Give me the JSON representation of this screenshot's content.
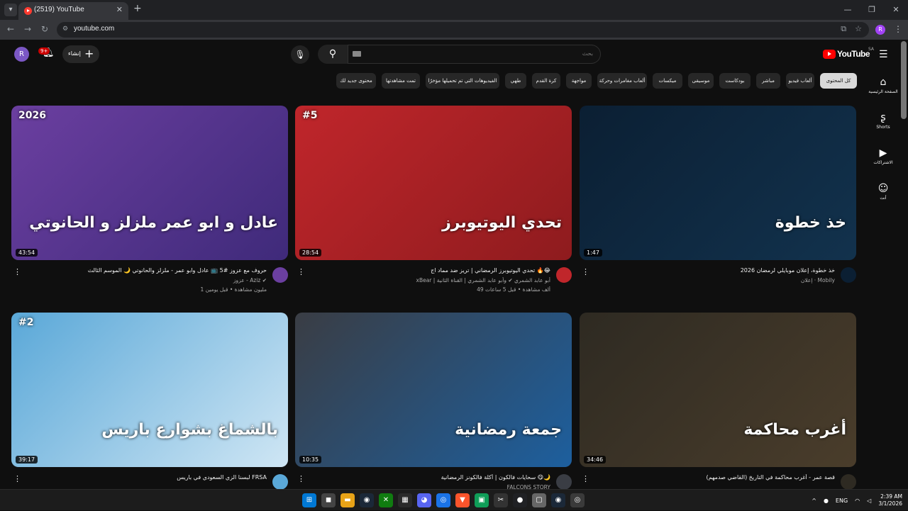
{
  "browser": {
    "tab_title": "(2519) YouTube",
    "url": "youtube.com",
    "profile_initial": "R"
  },
  "masthead": {
    "avatar_initial": "R",
    "notification_count": "9+",
    "create_label": "إنشاء",
    "search_placeholder": "بحث",
    "logo_text": "YouTube",
    "region": "SA"
  },
  "chips": [
    {
      "label": "كل المحتوى",
      "active": true
    },
    {
      "label": "ألعاب فيديو",
      "active": false
    },
    {
      "label": "مباشر",
      "active": false
    },
    {
      "label": "بودكاست",
      "active": false
    },
    {
      "label": "موسيقى",
      "active": false
    },
    {
      "label": "ميكسات",
      "active": false
    },
    {
      "label": "ألعاب مغامرات وحركة",
      "active": false
    },
    {
      "label": "مواجهة",
      "active": false
    },
    {
      "label": "كرة القدم",
      "active": false
    },
    {
      "label": "طهي",
      "active": false
    },
    {
      "label": "الفيديوهات التي تم تحميلها مؤخرًا",
      "active": false
    },
    {
      "label": "تمت مشاهدتها",
      "active": false
    },
    {
      "label": "محتوى جديد لك",
      "active": false
    }
  ],
  "guide": [
    {
      "label": "الصفحة الرئيسية",
      "icon": "home-icon"
    },
    {
      "label": "Shorts",
      "icon": "shorts-icon"
    },
    {
      "label": "الاشتراكات",
      "icon": "subscriptions-icon"
    },
    {
      "label": "أنت",
      "icon": "you-icon"
    }
  ],
  "videos": [
    {
      "duration": "1:47",
      "thumb_text": "خذ خطوة",
      "title": "خذ خطوة، إعلان موبايلي لرمضان 2026",
      "channel": "إعلان · Mobily",
      "stats": "",
      "colors": [
        "#0b1f33",
        "#12324d"
      ]
    },
    {
      "duration": "28:54",
      "thumb_text": "تحدي اليوتيوبرز",
      "badge": "#5",
      "title": "تحدي اليوتيوبرز الرمضاني | تريز ضد مماد اج 🔥😂",
      "channel": "xBear | أبو عابد الشمري ✔ وأبو عابد الشمري | القناة الثانية",
      "stats": "49 ألف مشاهدة • قبل 5 ساعات",
      "colors": [
        "#c0262b",
        "#8e1b1e"
      ]
    },
    {
      "duration": "43:54",
      "thumb_text": "عادل و ابو عمر ملزلز و الحانوتي",
      "badge": "2026",
      "title": "حروف مع عزوز #5 📺 عادل وابو عمر - ملزلز والحانوتي 🌙 الموسم الثالث",
      "channel": "عزوز - Aziz ✔",
      "stats": "1 مليون مشاهدة • قبل يومين",
      "colors": [
        "#6b3fa0",
        "#3f2a7a"
      ]
    },
    {
      "duration": "34:46",
      "thumb_text": "أغرب محاكمة",
      "title": "قصة عمر - أغرب محاكمة في التاريخ (القاضي صدمهم)",
      "channel": "",
      "stats": "",
      "colors": [
        "#2e2a22",
        "#4a3d2b"
      ]
    },
    {
      "duration": "10:35",
      "thumb_text": "جمعة رمضانية",
      "title": "سحايات فالكون | أكلة فالكونز الرمضانية 😋🌙",
      "channel": "FALCONS STORY",
      "stats": "",
      "colors": [
        "#3a3d44",
        "#1d5f9e"
      ]
    },
    {
      "duration": "39:17",
      "thumb_text": "بالشماغ بشوارع باريس",
      "badge": "#2",
      "title": "لبسنا الزي السعودي في باريس FRSA",
      "channel": "",
      "stats": "",
      "colors": [
        "#5aa8d8",
        "#cfe6f4"
      ]
    }
  ],
  "taskbar": {
    "language": "ENG",
    "time": "2:39 AM",
    "date": "3/1/2026"
  }
}
